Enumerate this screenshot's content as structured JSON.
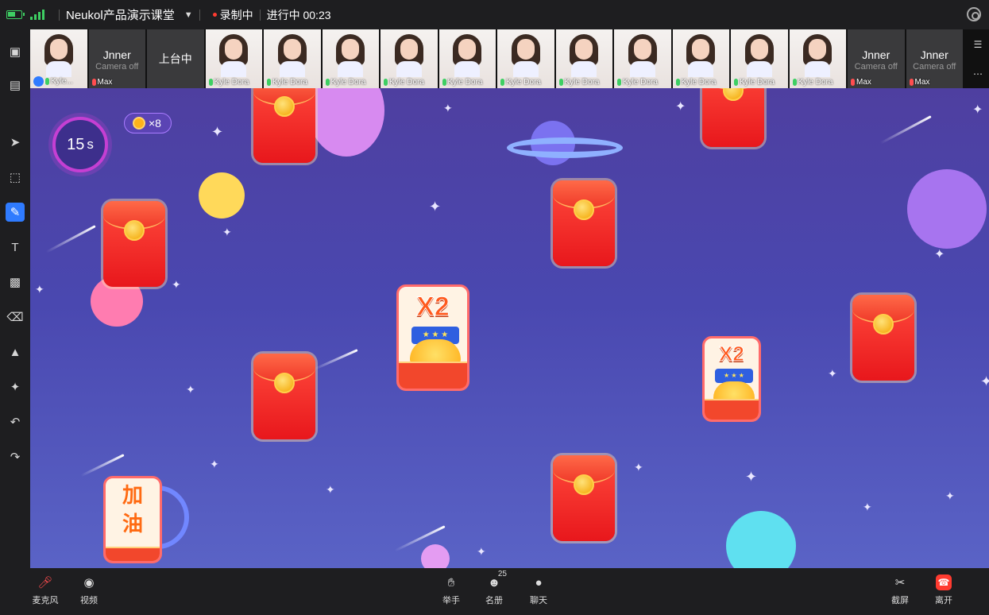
{
  "topbar": {
    "title": "Neukol产品演示课堂",
    "recording": "录制中",
    "status": "进行中 00:23"
  },
  "participants": [
    {
      "type": "camera",
      "label": "Kyle...",
      "teacher": true
    },
    {
      "type": "off",
      "name": "Jnner",
      "status": "Camera off",
      "sub": "Max"
    },
    {
      "type": "stage",
      "label": "上台中"
    },
    {
      "type": "camera",
      "label": "Kyle Dora"
    },
    {
      "type": "camera",
      "label": "Kyle Dora"
    },
    {
      "type": "camera",
      "label": "Kyle Dora"
    },
    {
      "type": "camera",
      "label": "Kyle Dora"
    },
    {
      "type": "camera",
      "label": "Kyle Dora"
    },
    {
      "type": "camera",
      "label": "Kyle Dora"
    },
    {
      "type": "camera",
      "label": "Kyle Dora"
    },
    {
      "type": "camera",
      "label": "Kyle Dora"
    },
    {
      "type": "camera",
      "label": "Kyle Dora"
    },
    {
      "type": "camera",
      "label": "Kyle Dora"
    },
    {
      "type": "camera",
      "label": "Kyle Dora"
    },
    {
      "type": "off",
      "name": "Jnner",
      "status": "Camera off",
      "sub": "Max"
    },
    {
      "type": "off",
      "name": "Jnner",
      "status": "Camera off",
      "sub": "Max"
    }
  ],
  "toolbar": {
    "tools": [
      "whiteboard",
      "screen-share",
      "select",
      "area-select",
      "pen",
      "text",
      "image",
      "eraser",
      "clear",
      "magic",
      "undo",
      "redo"
    ],
    "active": "pen"
  },
  "game": {
    "timer": "15",
    "timer_unit": "s",
    "coin_count": "×8",
    "cards": {
      "multiplier": "X2",
      "banner": "★ ★ ★",
      "cheer_1": "加",
      "cheer_2": "油"
    }
  },
  "bottombar": {
    "mic": "麦克风",
    "video": "视频",
    "raise_hand": "举手",
    "roster": "名册",
    "roster_count": "25",
    "chat": "聊天",
    "screenshot": "截屏",
    "leave": "离开"
  },
  "colors": {
    "accent": "#2f7bff",
    "record": "#ff3b30",
    "board_top": "#4e3fa0",
    "board_bottom": "#5a63c6"
  }
}
